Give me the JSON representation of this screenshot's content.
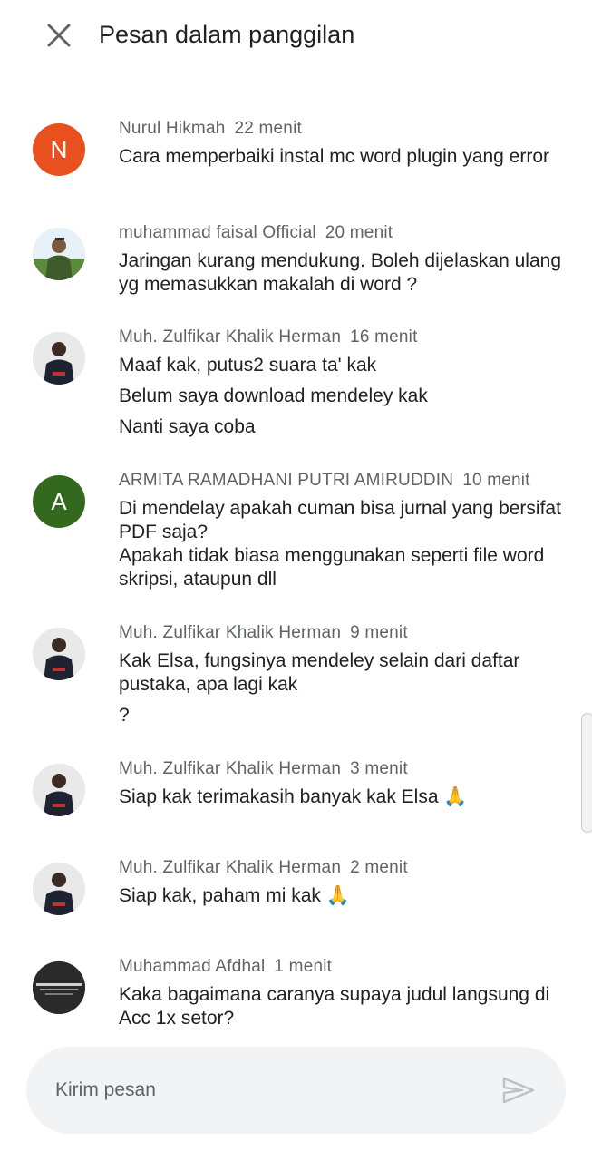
{
  "header": {
    "title": "Pesan dalam panggilan"
  },
  "messages": [
    {
      "sender": "Nurul Hikmah",
      "time": "22 menit",
      "avatar": {
        "letter": "N",
        "color": "#e8501f"
      },
      "lines": [
        "Cara memperbaiki instal mc word plugin yang error"
      ]
    },
    {
      "sender": "muhammad faisal Official",
      "time": "20 menit",
      "avatar": {
        "photo": "person-outdoor"
      },
      "lines": [
        "Jaringan kurang mendukung. Boleh dijelaskan ulang yg memasukkan makalah di word ?"
      ]
    },
    {
      "sender": "Muh. Zulfikar Khalik Herman",
      "time": "16 menit",
      "avatar": {
        "photo": "person-dark"
      },
      "lines": [
        "Maaf kak, putus2 suara ta' kak",
        "Belum saya download mendeley kak",
        "Nanti saya coba"
      ]
    },
    {
      "sender": "ARMITA RAMADHANI PUTRI AMIRUDDIN",
      "time": "10 menit",
      "avatar": {
        "letter": "A",
        "color": "#33691e"
      },
      "lines": [
        "Di mendelay apakah cuman bisa jurnal yang bersifat PDF saja?\nApakah tidak biasa menggunakan seperti file word skripsi, ataupun dll"
      ]
    },
    {
      "sender": "Muh. Zulfikar Khalik Herman",
      "time": "9 menit",
      "avatar": {
        "photo": "person-dark"
      },
      "lines": [
        "Kak Elsa, fungsinya mendeley selain dari daftar pustaka, apa lagi kak",
        "?"
      ]
    },
    {
      "sender": "Muh. Zulfikar Khalik Herman",
      "time": "3 menit",
      "avatar": {
        "photo": "person-dark"
      },
      "lines": [
        "Siap kak terimakasih banyak kak Elsa 🙏"
      ]
    },
    {
      "sender": "Muh. Zulfikar Khalik Herman",
      "time": "2 menit",
      "avatar": {
        "photo": "person-dark"
      },
      "lines": [
        "Siap kak, paham mi kak 🙏"
      ]
    },
    {
      "sender": "Muhammad Afdhal",
      "time": "1 menit",
      "avatar": {
        "photo": "text-logo"
      },
      "lines": [
        "Kaka bagaimana caranya supaya judul langsung di Acc 1x setor?"
      ]
    }
  ],
  "composer": {
    "placeholder": "Kirim pesan"
  },
  "icons": {
    "close": "close-icon",
    "send": "send-icon"
  }
}
